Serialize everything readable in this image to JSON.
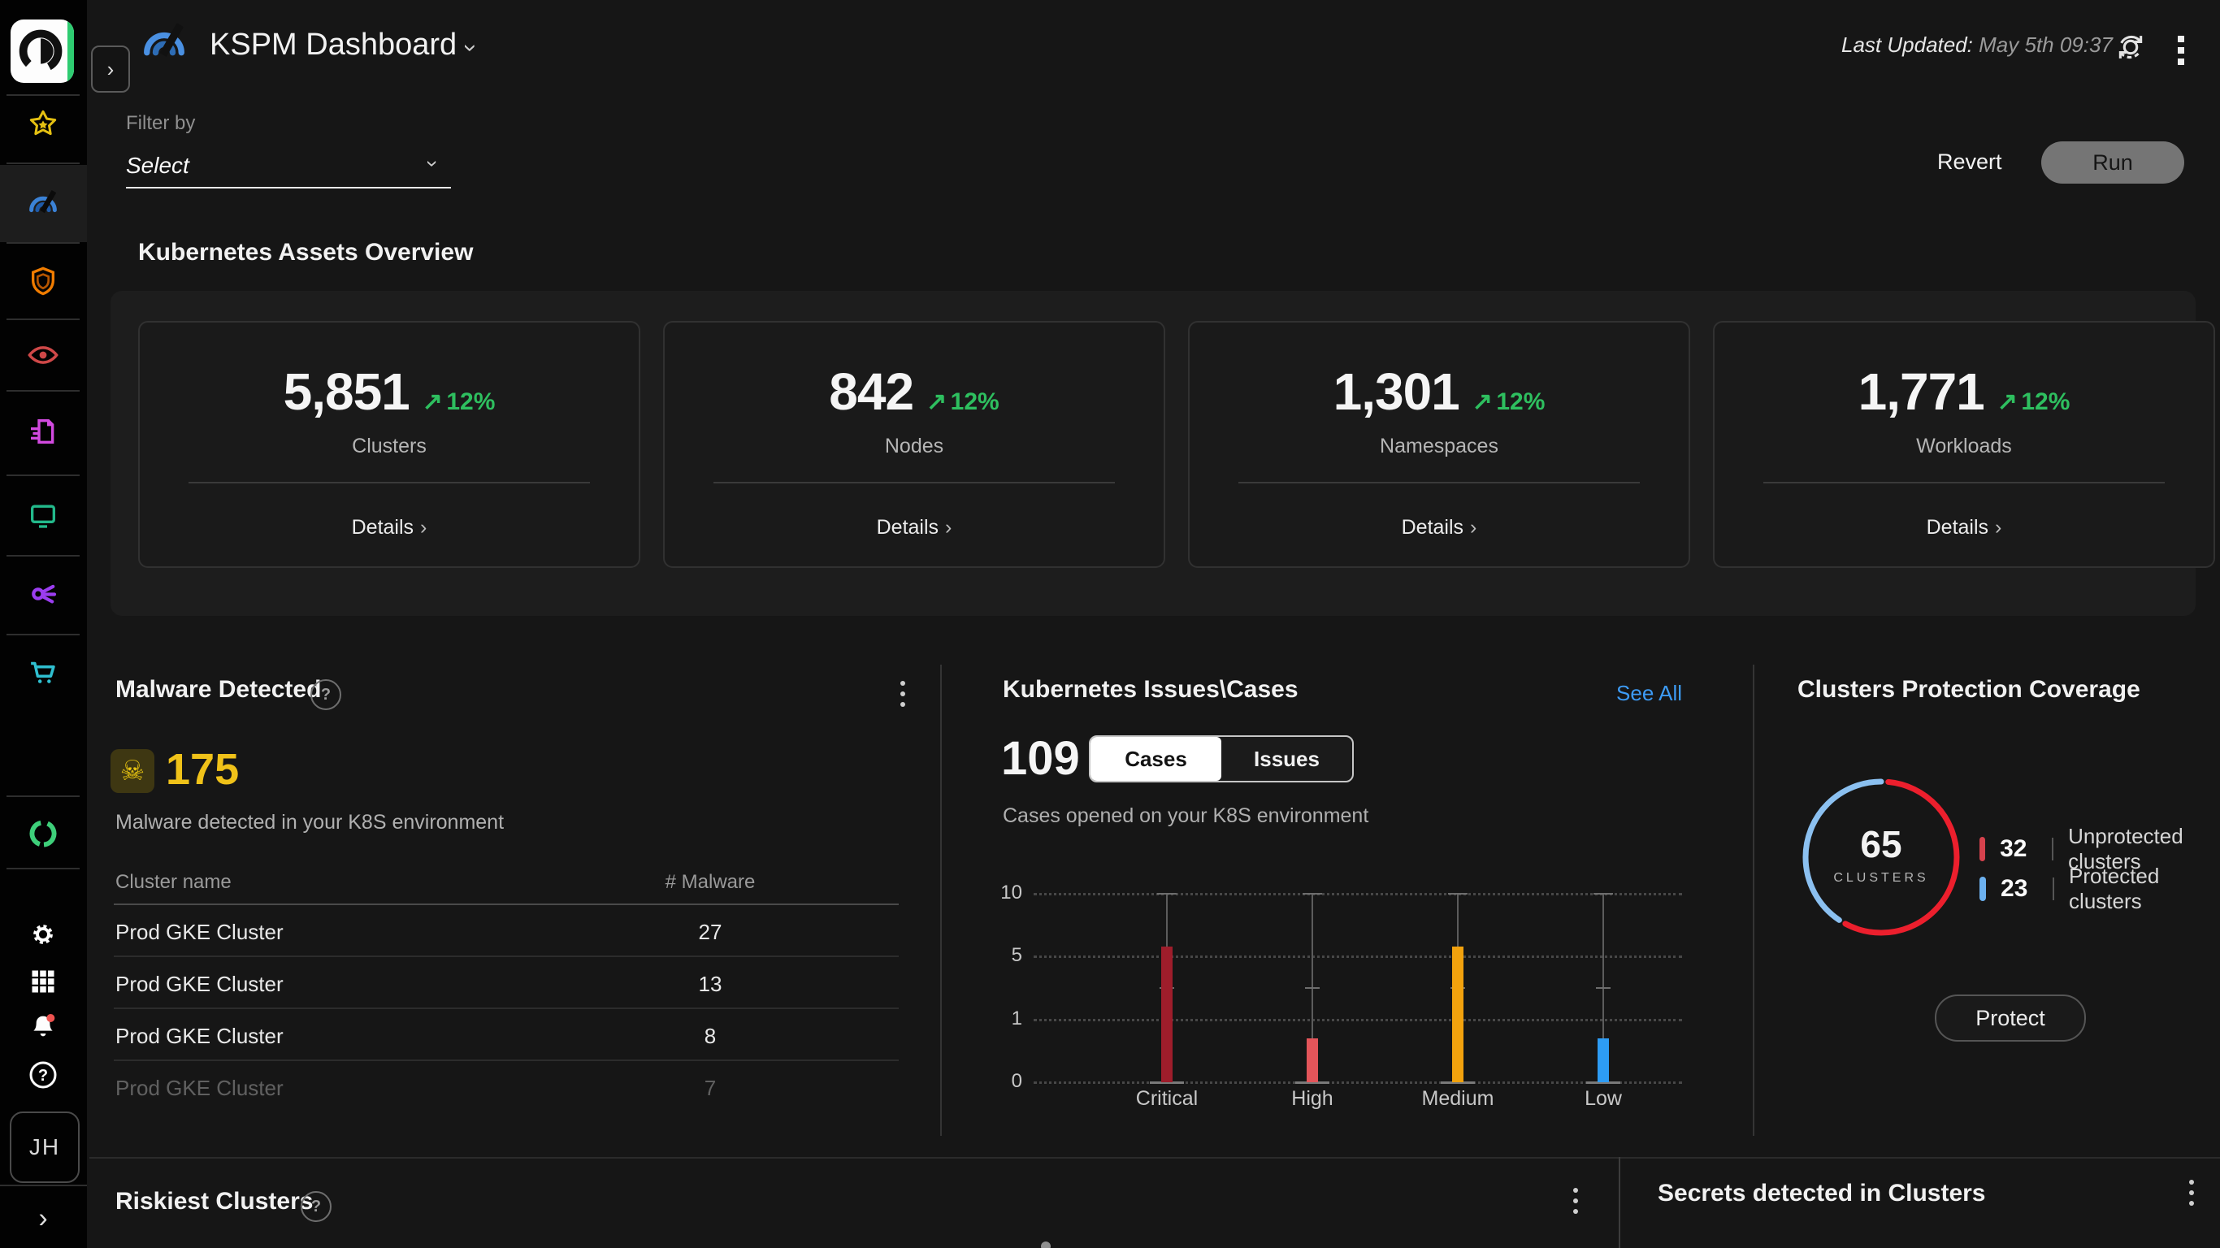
{
  "header": {
    "app_title": "KSPM Dashboard",
    "last_updated_label": "Last Updated:",
    "last_updated_value": "May 5th 09:37"
  },
  "filter": {
    "label": "Filter by",
    "value": "Select"
  },
  "actions": {
    "revert": "Revert",
    "run": "Run"
  },
  "assets": {
    "title": "Kubernetes Assets Overview",
    "details_label": "Details",
    "delta_color": "#2ebf5f",
    "cards": [
      {
        "value": "5,851",
        "delta": "12%",
        "label": "Clusters"
      },
      {
        "value": "842",
        "delta": "12%",
        "label": "Nodes"
      },
      {
        "value": "1,301",
        "delta": "12%",
        "label": "Namespaces"
      },
      {
        "value": "1,771",
        "delta": "12%",
        "label": "Workloads"
      }
    ]
  },
  "malware": {
    "title": "Malware Detected",
    "count": "175",
    "subtitle": "Malware detected in your K8S environment",
    "accent_color": "#f0c219",
    "table": {
      "headers": [
        "Cluster name",
        "# Malware"
      ],
      "rows": [
        {
          "name": "Prod GKE Cluster",
          "count": "27"
        },
        {
          "name": "Prod GKE Cluster",
          "count": "13"
        },
        {
          "name": "Prod GKE Cluster",
          "count": "8"
        },
        {
          "name": "Prod GKE Cluster",
          "count": "7"
        }
      ]
    }
  },
  "issues": {
    "title": "Kubernetes Issues\\Cases",
    "see_all": "See All",
    "count": "109",
    "tabs": {
      "active": "Cases",
      "options": [
        "Cases",
        "Issues"
      ]
    },
    "subtitle": "Cases opened on your K8S environment",
    "chart_data": {
      "type": "bar",
      "categories": [
        "Critical",
        "High",
        "Medium",
        "Low"
      ],
      "values": [
        5.8,
        0.7,
        5.8,
        0.7
      ],
      "colors": [
        "#9e1d2b",
        "#e4555a",
        "#f2a20d",
        "#2d9cf4"
      ],
      "yticks": [
        0,
        1,
        5,
        10
      ],
      "range": {
        "min": 0,
        "max": 10,
        "mid_tick": 3
      },
      "grid": "dotted horizontal",
      "ylabel": "",
      "xlabel": ""
    }
  },
  "coverage": {
    "title": "Clusters Protection Coverage",
    "total": "65",
    "total_label": "CLUSTERS",
    "protect_label": "Protect",
    "legend": [
      {
        "value": "32",
        "label": "Unprotected clusters",
        "color": "#d6424d"
      },
      {
        "value": "23",
        "label": "Protected clusters",
        "color": "#6cb1ef"
      }
    ],
    "chart_data": {
      "type": "pie",
      "slices": [
        {
          "label": "Unprotected clusters",
          "value": 32,
          "color": "#ec1f2d"
        },
        {
          "label": "Protected clusters",
          "value": 23,
          "color": "#8bc0f0"
        }
      ],
      "center_value": "65",
      "center_label": "CLUSTERS"
    }
  },
  "riskiest": {
    "title": "Riskiest Clusters"
  },
  "secrets": {
    "title": "Secrets detected in Clusters"
  },
  "sidebar": {
    "avatar": "JH",
    "icons": [
      "star",
      "kspm-dashboard",
      "shield",
      "eye",
      "report-document",
      "monitor",
      "connections",
      "cart",
      "ring-logo",
      "settings-gear",
      "apps-grid",
      "notifications-bell",
      "help",
      "avatar",
      "expand"
    ]
  }
}
